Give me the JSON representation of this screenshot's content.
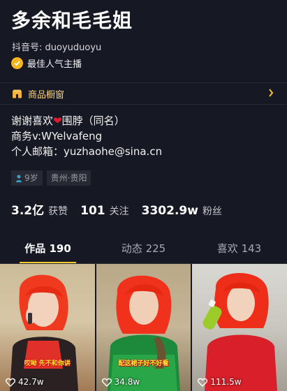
{
  "profile": {
    "name": "多余和毛毛姐",
    "douyin_id": "抖音号: duoyuduoyu",
    "certification": "最佳人气主播"
  },
  "shop": {
    "label": "商品橱窗"
  },
  "bio": {
    "line1_before": "谢谢喜欢",
    "line1_after": "围脖（同名）",
    "line2": "商务v:WYelvafeng",
    "line3": "个人邮箱：yuzhaohe@sina.cn"
  },
  "tags": {
    "age": "9岁",
    "location": "贵州·贵阳"
  },
  "stats": {
    "likes_value": "3.2亿",
    "likes_label": "获赞",
    "following_value": "101",
    "following_label": "关注",
    "followers_value": "3302.9w",
    "followers_label": "粉丝"
  },
  "tabs": [
    {
      "label": "作品 190"
    },
    {
      "label": "动态 225"
    },
    {
      "label": "喜欢 143"
    }
  ],
  "videos": [
    {
      "caption": "哎呦 先不和你讲",
      "likes": "42.7w"
    },
    {
      "caption": "配这裙子好不好看",
      "likes": "34.8w"
    },
    {
      "caption": "",
      "likes": "111.5w"
    }
  ],
  "colors": {
    "background": "#161823",
    "accent_yellow": "#fecc2f",
    "shop_text": "#f4d08a",
    "heart_red": "#e8192c"
  }
}
